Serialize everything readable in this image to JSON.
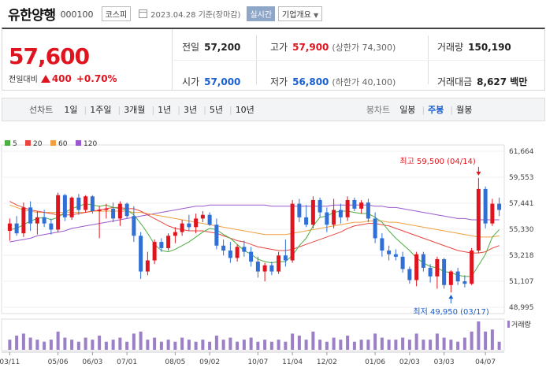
{
  "header": {
    "name": "유한양행",
    "code": "000100",
    "market": "코스피",
    "date": "2023.04.28 기준(장마감)",
    "realtime": "실시간",
    "company_info": "기업개요"
  },
  "quote": {
    "price": "57,600",
    "change_label": "전일대비",
    "change": "400",
    "change_pct": "+0.70%",
    "prev_label": "전일",
    "prev": "57,200",
    "high_label": "고가",
    "high": "57,900",
    "upper_limit": "(상한가 74,300)",
    "volume_label": "거래량",
    "volume": "150,190",
    "open_label": "시가",
    "open": "57,000",
    "low_label": "저가",
    "low": "56,800",
    "lower_limit": "(하한가 40,100)",
    "amount_label": "거래대금",
    "amount": "8,627 백만"
  },
  "toolbar": {
    "line_label": "선차트",
    "ranges": [
      "1일",
      "1주일",
      "3개월",
      "1년",
      "3년",
      "5년",
      "10년"
    ],
    "candle_label": "봉차트",
    "candles": [
      "일봉",
      "주봉",
      "월봉"
    ],
    "active_candle": "주봉"
  },
  "colors": {
    "up": "#e0141e",
    "down": "#2f6fd6",
    "ma5": "#4cae3f",
    "ma20": "#e8463f",
    "ma60": "#f0a040",
    "ma120": "#9b59d0",
    "volume": "#9b7fc7"
  },
  "chart_data": {
    "type": "candlestick",
    "legend": [
      "5",
      "20",
      "60",
      "120"
    ],
    "y_ticks": [
      "61,664",
      "59,553",
      "57,441",
      "55,330",
      "53,218",
      "51,107",
      "48,995"
    ],
    "ylim": [
      48995,
      61664
    ],
    "x_ticks": [
      "03/11",
      "05/06",
      "06/03",
      "07/01",
      "08/05",
      "09/02",
      "10/07",
      "11/04",
      "12/02",
      "01/06",
      "02/03",
      "03/03",
      "04/07"
    ],
    "max_label": "최고 59,500 (04/14)",
    "min_label": "최저 49,950 (03/17)",
    "volume_label": "거래량",
    "candles": [
      {
        "o": 55200,
        "h": 56200,
        "l": 54400,
        "c": 55800
      },
      {
        "o": 55800,
        "h": 56400,
        "l": 54800,
        "c": 55000
      },
      {
        "o": 55000,
        "h": 57500,
        "l": 54700,
        "c": 57100
      },
      {
        "o": 57100,
        "h": 57600,
        "l": 55200,
        "c": 55800
      },
      {
        "o": 55800,
        "h": 56800,
        "l": 54900,
        "c": 56300
      },
      {
        "o": 56300,
        "h": 56900,
        "l": 55500,
        "c": 55800
      },
      {
        "o": 55800,
        "h": 56200,
        "l": 54900,
        "c": 55300
      },
      {
        "o": 55300,
        "h": 58300,
        "l": 55100,
        "c": 58100
      },
      {
        "o": 58100,
        "h": 58200,
        "l": 56000,
        "c": 56300
      },
      {
        "o": 56300,
        "h": 58000,
        "l": 56100,
        "c": 57900
      },
      {
        "o": 57900,
        "h": 58200,
        "l": 56500,
        "c": 56900
      },
      {
        "o": 56900,
        "h": 58100,
        "l": 56700,
        "c": 58000
      },
      {
        "o": 58000,
        "h": 58100,
        "l": 56600,
        "c": 56800
      },
      {
        "o": 56800,
        "h": 57200,
        "l": 54600,
        "c": 56900
      },
      {
        "o": 56900,
        "h": 57400,
        "l": 56200,
        "c": 57000
      },
      {
        "o": 57000,
        "h": 57500,
        "l": 55900,
        "c": 56200
      },
      {
        "o": 56200,
        "h": 57600,
        "l": 55600,
        "c": 57400
      },
      {
        "o": 57400,
        "h": 57500,
        "l": 56200,
        "c": 56400
      },
      {
        "o": 56400,
        "h": 57200,
        "l": 54300,
        "c": 54800
      },
      {
        "o": 54800,
        "h": 55100,
        "l": 51300,
        "c": 51900
      },
      {
        "o": 51900,
        "h": 53500,
        "l": 51600,
        "c": 52800
      },
      {
        "o": 52800,
        "h": 54500,
        "l": 52500,
        "c": 54300
      },
      {
        "o": 54300,
        "h": 54600,
        "l": 53500,
        "c": 53800
      },
      {
        "o": 53800,
        "h": 55000,
        "l": 53600,
        "c": 54800
      },
      {
        "o": 54800,
        "h": 55500,
        "l": 54200,
        "c": 55100
      },
      {
        "o": 55100,
        "h": 56100,
        "l": 54800,
        "c": 55800
      },
      {
        "o": 55800,
        "h": 56500,
        "l": 55200,
        "c": 55500
      },
      {
        "o": 55500,
        "h": 56600,
        "l": 55000,
        "c": 56200
      },
      {
        "o": 56200,
        "h": 56800,
        "l": 55900,
        "c": 56500
      },
      {
        "o": 56500,
        "h": 56700,
        "l": 55600,
        "c": 55700
      },
      {
        "o": 55700,
        "h": 56200,
        "l": 53700,
        "c": 54000
      },
      {
        "o": 54000,
        "h": 54500,
        "l": 53200,
        "c": 53600
      },
      {
        "o": 53600,
        "h": 54300,
        "l": 52600,
        "c": 53000
      },
      {
        "o": 53000,
        "h": 54100,
        "l": 52700,
        "c": 53900
      },
      {
        "o": 53900,
        "h": 54400,
        "l": 53100,
        "c": 53500
      },
      {
        "o": 53500,
        "h": 53900,
        "l": 52300,
        "c": 52700
      },
      {
        "o": 52700,
        "h": 53100,
        "l": 51400,
        "c": 51900
      },
      {
        "o": 51900,
        "h": 52600,
        "l": 51100,
        "c": 52400
      },
      {
        "o": 52400,
        "h": 52700,
        "l": 51600,
        "c": 51900
      },
      {
        "o": 51900,
        "h": 53500,
        "l": 51700,
        "c": 53200
      },
      {
        "o": 53200,
        "h": 54500,
        "l": 52300,
        "c": 52800
      },
      {
        "o": 52800,
        "h": 57700,
        "l": 52600,
        "c": 57400
      },
      {
        "o": 57400,
        "h": 57800,
        "l": 55900,
        "c": 56300
      },
      {
        "o": 56300,
        "h": 57300,
        "l": 55500,
        "c": 55700
      },
      {
        "o": 55700,
        "h": 58000,
        "l": 55400,
        "c": 57700
      },
      {
        "o": 57700,
        "h": 57900,
        "l": 56300,
        "c": 56700
      },
      {
        "o": 56700,
        "h": 57100,
        "l": 55100,
        "c": 55700
      },
      {
        "o": 55700,
        "h": 57800,
        "l": 55400,
        "c": 56900
      },
      {
        "o": 56900,
        "h": 57400,
        "l": 55800,
        "c": 56300
      },
      {
        "o": 56300,
        "h": 58000,
        "l": 56000,
        "c": 57700
      },
      {
        "o": 57700,
        "h": 57900,
        "l": 56800,
        "c": 57000
      },
      {
        "o": 57000,
        "h": 57700,
        "l": 56600,
        "c": 57500
      },
      {
        "o": 57500,
        "h": 57800,
        "l": 55900,
        "c": 56200
      },
      {
        "o": 56200,
        "h": 56700,
        "l": 54200,
        "c": 54600
      },
      {
        "o": 54600,
        "h": 55000,
        "l": 53100,
        "c": 53600
      },
      {
        "o": 53600,
        "h": 54000,
        "l": 52800,
        "c": 53300
      },
      {
        "o": 53300,
        "h": 53700,
        "l": 52800,
        "c": 53100
      },
      {
        "o": 53100,
        "h": 53500,
        "l": 51800,
        "c": 52100
      },
      {
        "o": 52100,
        "h": 52300,
        "l": 50900,
        "c": 51200
      },
      {
        "o": 51200,
        "h": 53500,
        "l": 50700,
        "c": 53300
      },
      {
        "o": 53300,
        "h": 53500,
        "l": 51900,
        "c": 52200
      },
      {
        "o": 52200,
        "h": 52500,
        "l": 51000,
        "c": 51500
      },
      {
        "o": 51500,
        "h": 53100,
        "l": 50500,
        "c": 52900
      },
      {
        "o": 52900,
        "h": 53000,
        "l": 50500,
        "c": 50800
      },
      {
        "o": 50800,
        "h": 52000,
        "l": 50200,
        "c": 51900
      },
      {
        "o": 51900,
        "h": 52200,
        "l": 50800,
        "c": 51100
      },
      {
        "o": 51100,
        "h": 51600,
        "l": 50600,
        "c": 50900
      },
      {
        "o": 50900,
        "h": 53800,
        "l": 50800,
        "c": 53600
      },
      {
        "o": 53600,
        "h": 59500,
        "l": 53400,
        "c": 58600
      },
      {
        "o": 58600,
        "h": 58800,
        "l": 55400,
        "c": 55800
      },
      {
        "o": 55800,
        "h": 57800,
        "l": 55600,
        "c": 57400
      },
      {
        "o": 57400,
        "h": 57900,
        "l": 56400,
        "c": 56900
      }
    ],
    "ma5": [
      55300,
      55400,
      55700,
      56000,
      56200,
      56300,
      56100,
      56300,
      56700,
      57000,
      57200,
      57400,
      57300,
      57200,
      57300,
      57100,
      57000,
      56900,
      56500,
      55800,
      55000,
      54100,
      53600,
      53500,
      53700,
      54000,
      54300,
      54700,
      55100,
      55400,
      55300,
      54900,
      54600,
      54100,
      53600,
      53300,
      52900,
      52700,
      52600,
      52700,
      52700,
      53200,
      54000,
      54600,
      55600,
      56300,
      56400,
      56700,
      56800,
      56800,
      56700,
      56600,
      56600,
      56300,
      55900,
      55200,
      54600,
      54100,
      53600,
      53000,
      52600,
      52300,
      52200,
      51900,
      51800,
      51600,
      51500,
      51500,
      52400,
      53300,
      54700,
      55300
    ],
    "ma20": [
      57600,
      57300,
      57100,
      56900,
      56800,
      56700,
      56600,
      56500,
      56500,
      56500,
      56600,
      56700,
      56800,
      56900,
      57000,
      57100,
      57100,
      57000,
      57000,
      56800,
      56500,
      56200,
      55900,
      55600,
      55400,
      55300,
      55200,
      55200,
      55200,
      55100,
      55000,
      54800,
      54600,
      54400,
      54300,
      54100,
      53900,
      53800,
      53700,
      53600,
      53600,
      53700,
      53900,
      54100,
      54300,
      54500,
      54700,
      54900,
      55100,
      55400,
      55600,
      55700,
      55800,
      55800,
      55700,
      55600,
      55400,
      55200,
      55000,
      54800,
      54600,
      54400,
      54200,
      54000,
      53800,
      53600,
      53500,
      53400,
      53400,
      53500,
      53800,
      54000
    ],
    "ma60": [
      57300,
      57100,
      56900,
      56800,
      56700,
      56700,
      56700,
      56700,
      56700,
      56700,
      56700,
      56700,
      56800,
      56800,
      56800,
      56800,
      56800,
      56800,
      56700,
      56700,
      56600,
      56500,
      56400,
      56300,
      56200,
      56100,
      56000,
      55900,
      55800,
      55700,
      55600,
      55500,
      55400,
      55300,
      55200,
      55100,
      55000,
      54900,
      54900,
      54900,
      54900,
      55000,
      55100,
      55200,
      55300,
      55400,
      55500,
      55600,
      55700,
      55800,
      55900,
      55900,
      56000,
      56000,
      56000,
      55900,
      55900,
      55800,
      55700,
      55600,
      55500,
      55400,
      55300,
      55200,
      55100,
      55000,
      54900,
      54800,
      54700,
      54700,
      54700,
      54800
    ],
    "ma120": [
      54300,
      54400,
      54500,
      54600,
      54800,
      54900,
      55000,
      55100,
      55200,
      55400,
      55500,
      55600,
      55700,
      55800,
      55900,
      56000,
      56100,
      56200,
      56300,
      56400,
      56500,
      56600,
      56700,
      56800,
      56900,
      57000,
      57100,
      57200,
      57200,
      57300,
      57300,
      57300,
      57300,
      57300,
      57300,
      57300,
      57300,
      57300,
      57200,
      57200,
      57200,
      57200,
      57200,
      57200,
      57200,
      57200,
      57200,
      57300,
      57300,
      57300,
      57300,
      57300,
      57300,
      57200,
      57200,
      57100,
      57100,
      57000,
      56900,
      56800,
      56700,
      56600,
      56500,
      56400,
      56300,
      56200,
      56200,
      56100,
      56100,
      56100,
      56100,
      56100
    ],
    "volume": [
      5,
      7,
      8,
      6,
      5,
      4,
      5,
      9,
      6,
      5,
      4,
      6,
      5,
      7,
      4,
      5,
      6,
      4,
      8,
      9,
      5,
      6,
      4,
      5,
      4,
      6,
      5,
      4,
      5,
      4,
      7,
      5,
      6,
      4,
      5,
      6,
      4,
      5,
      4,
      5,
      4,
      8,
      7,
      5,
      9,
      5,
      4,
      6,
      5,
      7,
      4,
      5,
      5,
      8,
      6,
      5,
      5,
      6,
      5,
      8,
      5,
      5,
      8,
      6,
      5,
      4,
      6,
      9,
      14,
      9,
      10,
      4
    ]
  }
}
